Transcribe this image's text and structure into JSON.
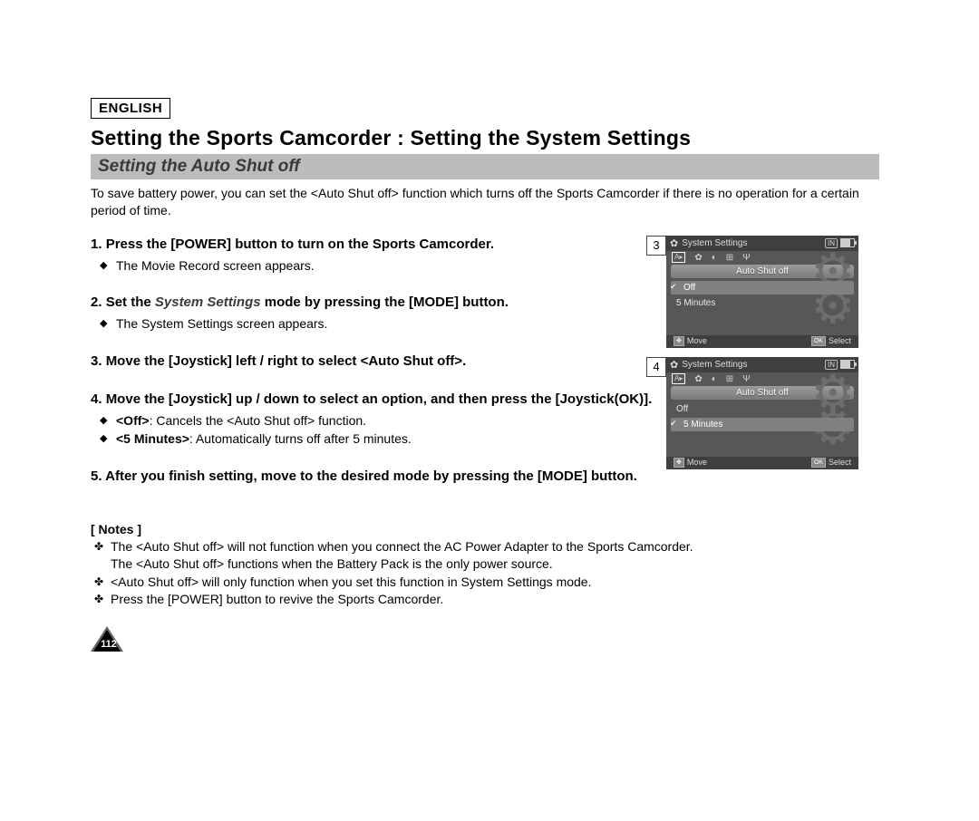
{
  "lang_tag": "ENGLISH",
  "page_title": "Setting the Sports Camcorder : Setting the System Settings",
  "section_title": "Setting the Auto Shut off",
  "intro": "To save battery power, you can set the <Auto Shut off> function which turns off the Sports Camcorder if there is no operation for a certain period of time.",
  "steps": {
    "s1": {
      "head": "Press the [POWER] button to turn on the Sports Camcorder.",
      "sub1": "The Movie Record screen appears."
    },
    "s2": {
      "head_pre": "Set the ",
      "head_em": "System Settings",
      "head_post": " mode by pressing the [MODE] button.",
      "sub1": "The System Settings screen appears."
    },
    "s3": {
      "head": "Move the [Joystick] left / right to select <Auto Shut off>."
    },
    "s4": {
      "head": "Move the [Joystick] up / down to select an option, and then press the [Joystick(OK)].",
      "sub1_b": "<Off>",
      "sub1_t": ": Cancels the <Auto Shut off> function.",
      "sub2_b": "<5 Minutes>",
      "sub2_t": ": Automatically turns off after 5 minutes."
    },
    "s5": {
      "head": "After you finish setting, move to the desired mode by pressing the [MODE] button."
    }
  },
  "notes": {
    "heading": "[ Notes ]",
    "n1a": "The <Auto Shut off> will not function when you connect the AC Power Adapter to the Sports Camcorder.",
    "n1b": "The <Auto Shut off> functions when the Battery Pack is the only power source.",
    "n2": "<Auto Shut off> will only function when you set this function in System Settings mode.",
    "n3": "Press the [POWER] button to revive the Sports Camcorder."
  },
  "page_number": "112",
  "screens": {
    "a": {
      "num": "3",
      "title": "System Settings",
      "tab": "Auto Shut off",
      "badge": "IN",
      "opt1": "Off",
      "opt1_checked": true,
      "opt2": "5 Minutes",
      "foot_move_key": "✥",
      "foot_move": "Move",
      "foot_sel_key": "OK",
      "foot_sel": "Select"
    },
    "b": {
      "num": "4",
      "title": "System Settings",
      "tab": "Auto Shut off",
      "badge": "IN",
      "opt1": "Off",
      "opt2": "5 Minutes",
      "opt2_checked": true,
      "foot_move_key": "✥",
      "foot_move": "Move",
      "foot_sel_key": "OK",
      "foot_sel": "Select"
    }
  }
}
